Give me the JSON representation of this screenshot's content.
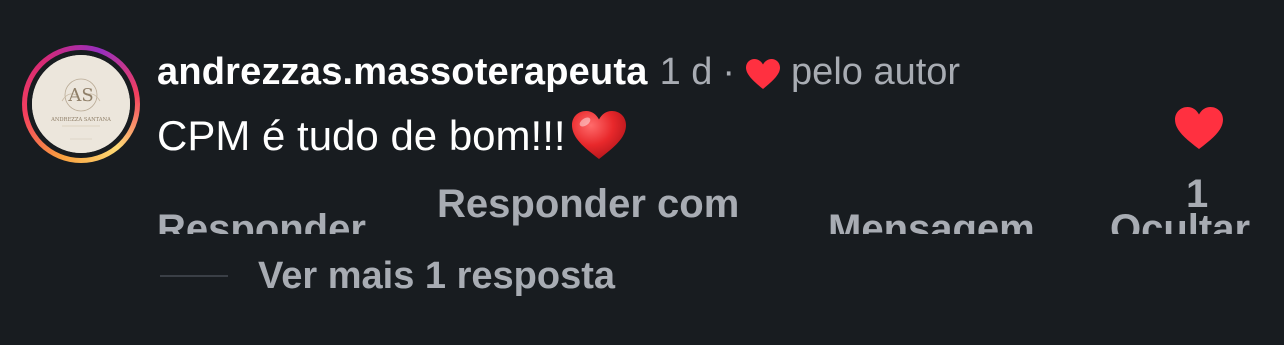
{
  "comment": {
    "avatar_monogram": "AS",
    "avatar_name": "ANDREZZA SANTANA",
    "username": "andrezzas.massoterapeuta",
    "time": "1 d",
    "separator": "·",
    "author_like_label": "pelo autor",
    "text": "CPM é tudo de bom!!!",
    "like_count": "1",
    "colors": {
      "background": "#181c20",
      "secondary_text": "#a8acb3",
      "heart": "#ff3040"
    }
  },
  "actions": {
    "reply": "Responder",
    "reply_with": "Responder com",
    "message": "Mensagem",
    "hide": "Ocultar"
  },
  "replies": {
    "view_more": "Ver mais 1 resposta"
  }
}
